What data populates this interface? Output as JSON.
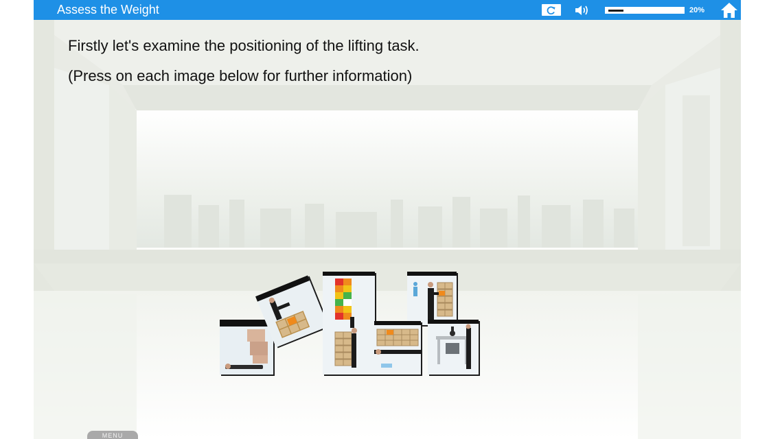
{
  "header": {
    "title": "Assess the Weight",
    "refresh_icon": "refresh-icon",
    "sound_icon": "speaker-icon",
    "progress_value": 0.2,
    "progress_label": "20%",
    "home_icon": "home-icon"
  },
  "content": {
    "line1": "Firstly let's examine the positioning of the lifting task.",
    "line2": "(Press on each image below for further information)"
  },
  "tiles": [
    {
      "name": "tile-boxes-on-floor"
    },
    {
      "name": "tile-worker-kneeling-boxes"
    },
    {
      "name": "tile-height-zones-chart"
    },
    {
      "name": "tile-worker-boxes-shelf"
    },
    {
      "name": "tile-lifting-grid"
    },
    {
      "name": "tile-worker-lying"
    },
    {
      "name": "tile-workstation-chair"
    }
  ],
  "menu": {
    "label": "MENU"
  },
  "colors": {
    "topbar": "#1e90e6",
    "text": "#111111",
    "zone_red": "#e2332b",
    "zone_orange": "#f08a1c",
    "zone_yellow": "#f2c316",
    "zone_green": "#46b34b"
  }
}
